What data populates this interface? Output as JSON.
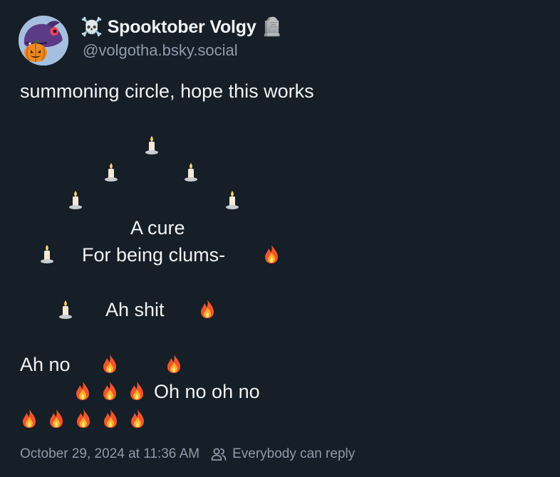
{
  "author": {
    "skull_emoji": "☠️",
    "display_name": "Spooktober Volgy",
    "tombstone_emoji": "🪦",
    "handle": "@volgotha.bsky.social",
    "avatar_icon": "dragon-pumpkin-avatar"
  },
  "post": {
    "text_intro": "summoning circle, hope this works",
    "line_a_cure": "A cure",
    "line_being_clums": "For being clums-",
    "line_ah_shit": "Ah shit",
    "line_ah_no": "Ah no",
    "line_oh_no": "Oh no oh no",
    "candle_emoji": "🕯️",
    "fire_emoji": "🔥"
  },
  "footer": {
    "timestamp": "October 29, 2024 at 11:36 AM",
    "people_icon": "people-icon",
    "reply_setting": "Everybody can reply"
  },
  "colors": {
    "background": "#161e27",
    "text": "#f1f3f5",
    "muted": "#8f9bab"
  }
}
